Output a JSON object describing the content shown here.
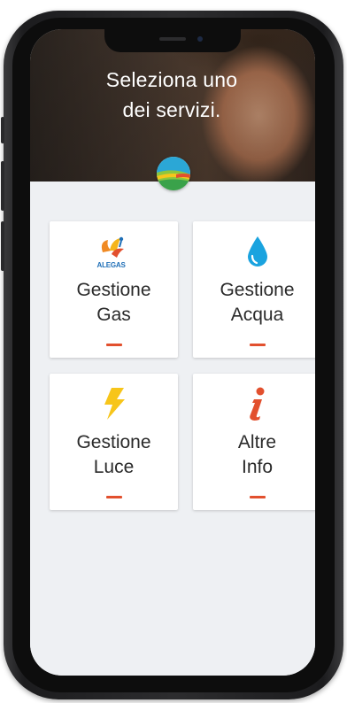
{
  "header": {
    "title_line1": "Seleziona uno",
    "title_line2": "dei servizi."
  },
  "services": [
    {
      "line1": "Gestione",
      "line2": "Gas",
      "icon": "alegas-logo-icon"
    },
    {
      "line1": "Gestione",
      "line2": "Acqua",
      "icon": "water-drop-icon"
    },
    {
      "line1": "Gestione",
      "line2": "Luce",
      "icon": "lightning-bolt-icon"
    },
    {
      "line1": "Altre",
      "line2": "Info",
      "icon": "info-icon"
    }
  ],
  "brand_text": "ALEGAS",
  "colors": {
    "accent": "#e2502e",
    "water": "#1aa3df",
    "bolt": "#f7c51a",
    "info": "#e2502e"
  }
}
